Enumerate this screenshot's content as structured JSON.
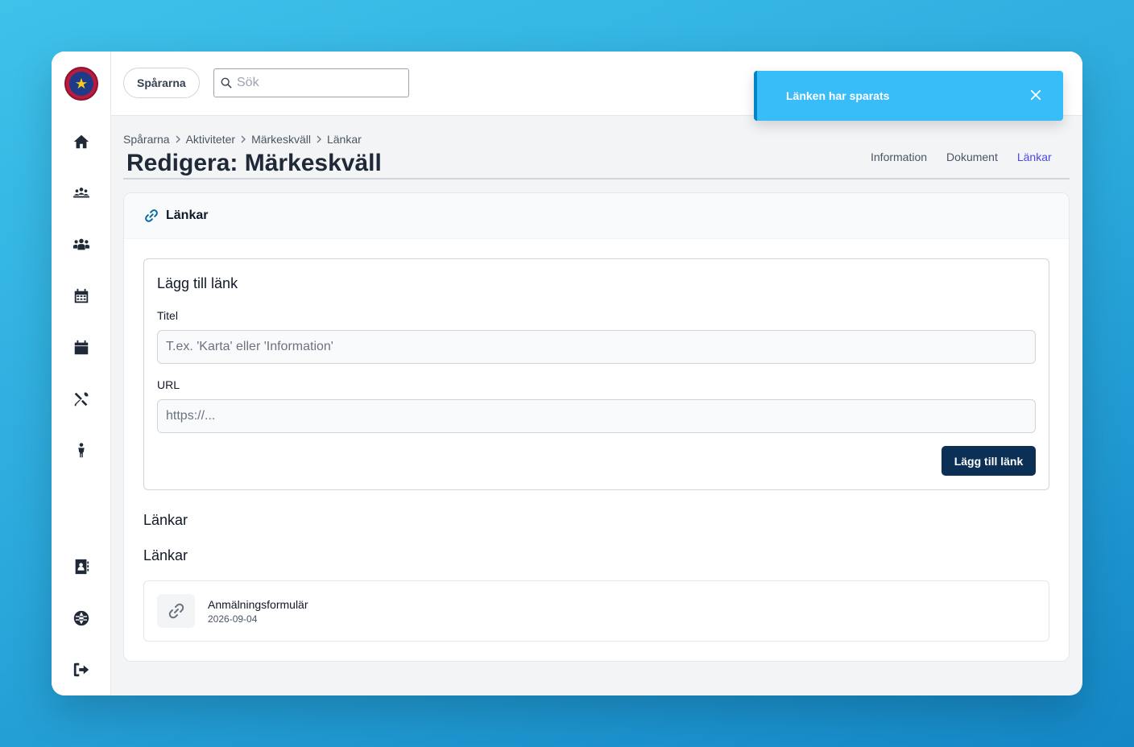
{
  "topbar": {
    "org_label": "Spårarna",
    "search_placeholder": "Sök"
  },
  "sidebar": {
    "items": [
      {
        "icon": "home-icon"
      },
      {
        "icon": "group-meeting-icon"
      },
      {
        "icon": "users-icon"
      },
      {
        "icon": "calendar-grid-icon"
      },
      {
        "icon": "calendar-icon"
      },
      {
        "icon": "tools-icon"
      },
      {
        "icon": "child-icon"
      }
    ],
    "bottom_items": [
      {
        "icon": "address-book-icon"
      },
      {
        "icon": "globe-icon"
      },
      {
        "icon": "logout-icon"
      }
    ]
  },
  "breadcrumb": [
    "Spårarna",
    "Aktiviteter",
    "Märkeskväll",
    "Länkar"
  ],
  "page_title": "Redigera: Märkeskväll",
  "tabs": [
    {
      "label": "Information",
      "active": false
    },
    {
      "label": "Dokument",
      "active": false
    },
    {
      "label": "Länkar",
      "active": true
    }
  ],
  "card": {
    "header_title": "Länkar",
    "form": {
      "title": "Lägg till länk",
      "title_label": "Titel",
      "title_placeholder": "T.ex. 'Karta' eller 'Information'",
      "url_label": "URL",
      "url_placeholder": "https://...",
      "submit_label": "Lägg till länk"
    },
    "section_heading_1": "Länkar",
    "section_heading_2": "Länkar",
    "links": [
      {
        "title": "Anmälningsformulär",
        "date": "2026-09-04"
      }
    ]
  },
  "toast": {
    "message": "Länken har sparats"
  },
  "colors": {
    "primary_button": "#0b2f55",
    "active_tab": "#4f46e5",
    "toast_bg": "#38bdf8"
  }
}
